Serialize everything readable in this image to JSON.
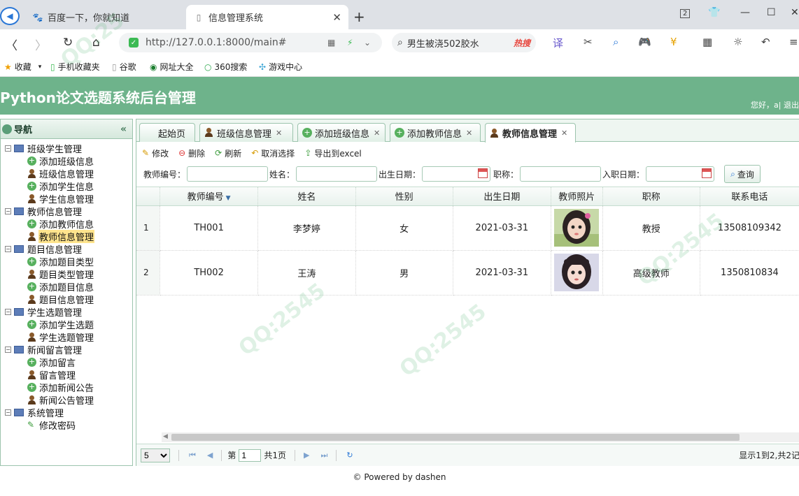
{
  "browser": {
    "tabs": [
      {
        "title": "百度一下，你就知道",
        "icon": "baidu-icon"
      },
      {
        "title": "信息管理系统",
        "icon": "page-icon"
      }
    ],
    "tab_count": "2",
    "url": "http://127.0.0.1:8000/main#",
    "search_text": "男生被浇502胶水",
    "search_badge": "热搜",
    "bookmarks": [
      "收藏",
      "手机收藏夹",
      "谷歌",
      "网址大全",
      "360搜索",
      "游戏中心"
    ]
  },
  "app": {
    "title": "Python论文选题系统后台管理",
    "user_info": "您好，a| 退出"
  },
  "nav": {
    "title": "导航",
    "groups": [
      {
        "label": "班级学生管理",
        "items": [
          {
            "label": "添加班级信息",
            "icon": "add"
          },
          {
            "label": "班级信息管理",
            "icon": "person"
          },
          {
            "label": "添加学生信息",
            "icon": "add"
          },
          {
            "label": "学生信息管理",
            "icon": "person"
          }
        ]
      },
      {
        "label": "教师信息管理",
        "items": [
          {
            "label": "添加教师信息",
            "icon": "add"
          },
          {
            "label": "教师信息管理",
            "icon": "person",
            "selected": true
          }
        ]
      },
      {
        "label": "题目信息管理",
        "items": [
          {
            "label": "添加题目类型",
            "icon": "add"
          },
          {
            "label": "题目类型管理",
            "icon": "person"
          },
          {
            "label": "添加题目信息",
            "icon": "add"
          },
          {
            "label": "题目信息管理",
            "icon": "person"
          }
        ]
      },
      {
        "label": "学生选题管理",
        "items": [
          {
            "label": "添加学生选题",
            "icon": "add"
          },
          {
            "label": "学生选题管理",
            "icon": "person"
          }
        ]
      },
      {
        "label": "新闻留言管理",
        "items": [
          {
            "label": "添加留言",
            "icon": "add"
          },
          {
            "label": "留言管理",
            "icon": "person"
          },
          {
            "label": "添加新闻公告",
            "icon": "add"
          },
          {
            "label": "新闻公告管理",
            "icon": "person"
          }
        ]
      },
      {
        "label": "系统管理",
        "items": [
          {
            "label": "修改密码",
            "icon": "pencil"
          }
        ]
      }
    ]
  },
  "content_tabs": [
    {
      "label": "起始页",
      "icon": "none",
      "closable": false
    },
    {
      "label": "班级信息管理",
      "icon": "person",
      "closable": true
    },
    {
      "label": "添加班级信息",
      "icon": "add",
      "closable": true
    },
    {
      "label": "添加教师信息",
      "icon": "add",
      "closable": true
    },
    {
      "label": "教师信息管理",
      "icon": "person",
      "closable": true,
      "active": true
    }
  ],
  "toolbar": {
    "edit": "修改",
    "delete": "删除",
    "refresh": "刷新",
    "cancel_select": "取消选择",
    "export": "导出到excel"
  },
  "search": {
    "teacher_no": "教师编号：",
    "name": "姓名：",
    "birth_date": "出生日期：",
    "title": "职称：",
    "hire_date": "入职日期：",
    "query": "查询"
  },
  "grid": {
    "columns": [
      "教师编号",
      "姓名",
      "性别",
      "出生日期",
      "教师照片",
      "职称",
      "联系电话"
    ],
    "rows": [
      {
        "no": "1",
        "teacher_no": "TH001",
        "name": "李梦婷",
        "gender": "女",
        "birth": "2021-03-31",
        "title": "教授",
        "phone": "13508109342"
      },
      {
        "no": "2",
        "teacher_no": "TH002",
        "name": "王涛",
        "gender": "男",
        "birth": "2021-03-31",
        "title": "高级教师",
        "phone": "1350810834"
      }
    ]
  },
  "pager": {
    "page_size": "5",
    "page_label": "第",
    "page": "1",
    "total_pages": "共1页",
    "info": "显示1到2,共2记"
  },
  "footer": "© Powered by dashen",
  "colors": {
    "header": "#6eb38b",
    "border": "#9cc4ad",
    "selected": "#ffe48d"
  }
}
